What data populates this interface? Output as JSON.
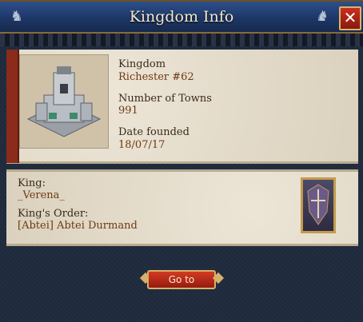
{
  "window": {
    "title": "Kingdom Info",
    "close_label": "✕"
  },
  "kingdom": {
    "kingdom_label": "Kingdom",
    "kingdom_value": "Richester #62",
    "towns_label": "Number of Towns",
    "towns_value": "991",
    "founded_label": "Date founded",
    "founded_value": "18/07/17"
  },
  "ruler": {
    "king_label": "King:",
    "king_value": "_Verena_",
    "order_label": "King's Order:",
    "order_value": "[Abtei] Abtei Durmand"
  },
  "actions": {
    "goto_label": "Go to"
  },
  "colors": {
    "title_bar": "#1d3766",
    "parchment": "#e6dcc8",
    "value_text": "#6e3a12",
    "button": "#c8301f"
  }
}
